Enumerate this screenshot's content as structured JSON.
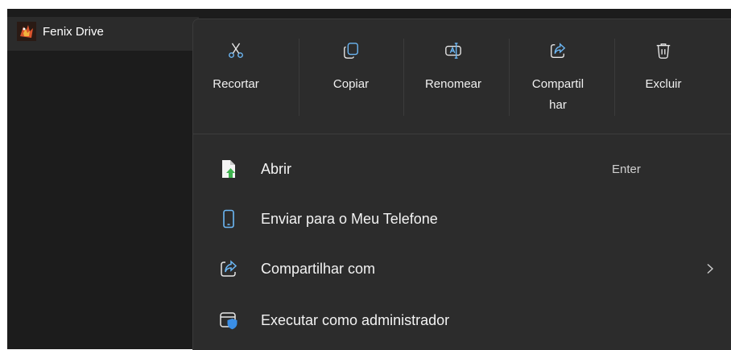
{
  "file": {
    "name": "Fenix Drive",
    "icon": "app-icon"
  },
  "quick_actions": [
    {
      "label": "Recortar",
      "icon": "scissors-icon"
    },
    {
      "label": "Copiar",
      "icon": "copy-icon"
    },
    {
      "label": "Renomear",
      "icon": "rename-icon"
    },
    {
      "label": "Compartil\nhar",
      "icon": "share-icon"
    },
    {
      "label": "Excluir",
      "icon": "trash-icon"
    }
  ],
  "items": [
    {
      "label": "Abrir",
      "shortcut": "Enter",
      "icon": "open-file-icon"
    },
    {
      "label": "Enviar para o Meu Telefone",
      "icon": "phone-icon"
    },
    {
      "label": "Compartilhar com",
      "icon": "share-icon",
      "submenu": true
    },
    {
      "label": "Executar como administrador",
      "icon": "admin-shield-icon"
    }
  ],
  "colors": {
    "menu_bg": "#2c2c2c",
    "desktop_bg": "#1c1c1c",
    "accent": "#6cb8f6",
    "open_file_green": "#3fb34f"
  }
}
